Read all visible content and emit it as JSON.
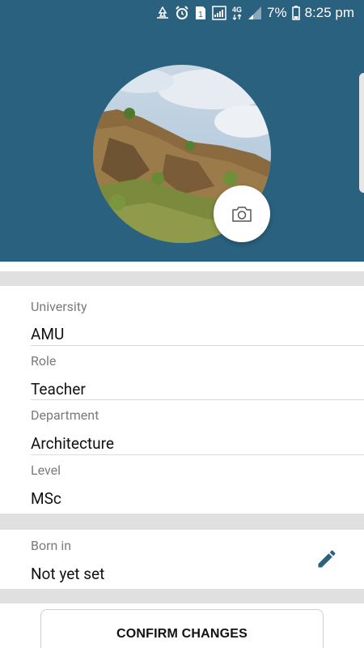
{
  "status_bar": {
    "battery": "7%",
    "time": "8:25 pm",
    "network": "4G",
    "sim_badge": "1",
    "icons": [
      "recycle-icon",
      "alarm-icon",
      "sim-icon",
      "signal-icon",
      "network-4g-icon",
      "signal-bars-icon",
      "battery-icon"
    ]
  },
  "profile": {
    "photo_icon": "camera-icon"
  },
  "fields": {
    "university": {
      "label": "University",
      "value": "AMU"
    },
    "role": {
      "label": "Role",
      "value": "Teacher"
    },
    "department": {
      "label": "Department",
      "value": "Architecture"
    },
    "level": {
      "label": "Level",
      "value": "MSc"
    },
    "born_in": {
      "label": "Born in",
      "value": "Not yet set",
      "action_icon": "edit-pencil-icon"
    }
  },
  "actions": {
    "confirm_label": "CONFIRM CHANGES"
  },
  "colors": {
    "header": "#2a617e",
    "edit_icon": "#2a617e",
    "separator": "#e0e0e0"
  }
}
